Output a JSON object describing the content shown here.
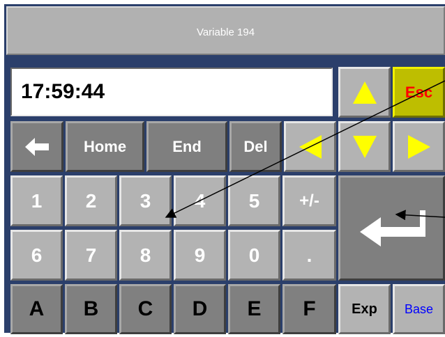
{
  "title": "Variable 194",
  "display_value": "17:59:44",
  "nav_keys": {
    "backspace_icon": "left-arrow-icon",
    "home": "Home",
    "end": "End",
    "del": "Del"
  },
  "arrow_keys": {
    "up": "up-arrow-icon",
    "down": "down-arrow-icon",
    "left": "left-arrow-icon",
    "right": "right-arrow-icon"
  },
  "esc_label": "Esc",
  "digits_row1": [
    "1",
    "2",
    "3",
    "4",
    "5",
    "+/-"
  ],
  "digits_row2": [
    "6",
    "7",
    "8",
    "9",
    "0",
    "."
  ],
  "hex_row": [
    "A",
    "B",
    "C",
    "D",
    "E",
    "F"
  ],
  "exp_label": "Exp",
  "base_label": "Base",
  "enter_icon": "enter-icon",
  "colors": {
    "frame": "#2b3f6b",
    "key_light": "#b3b3b3",
    "key_dark": "#7f7f7f",
    "esc_background": "#bebe00",
    "esc_text": "#ff0000",
    "arrow_yellow": "#ffff00",
    "base_text": "#0000ff"
  }
}
